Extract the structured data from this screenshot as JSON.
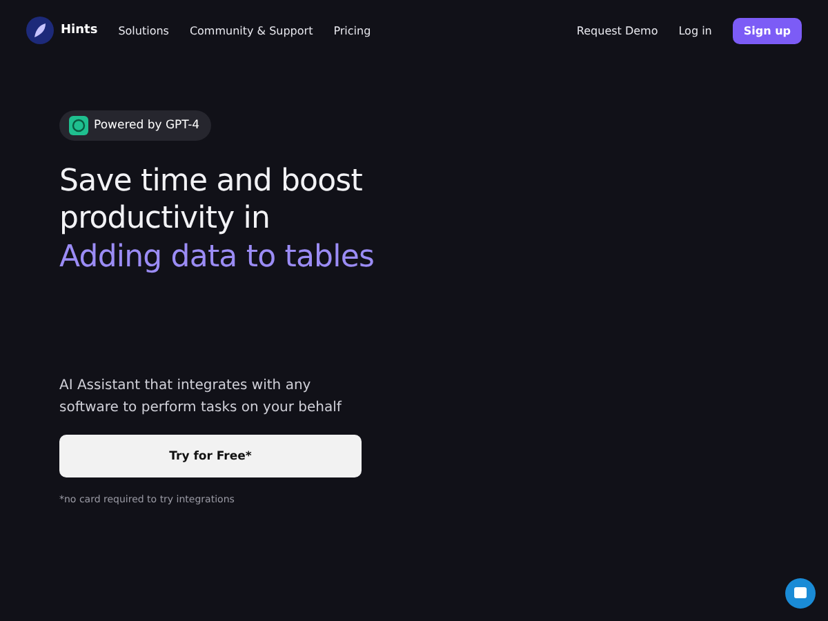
{
  "nav": {
    "brand": "Hints",
    "links": [
      "Solutions",
      "Community & Support",
      "Pricing"
    ],
    "actions": [
      "Request Demo",
      "Log in"
    ],
    "cta": "Sign up"
  },
  "hero": {
    "badge": "Powered by GPT-4",
    "title": "Save time and boost productivity in",
    "highlight": "Adding data to tables",
    "description": "AI Assistant that integrates with any software to perform tasks on your behalf",
    "button": "Try for Free*",
    "note": "*no card required to try integrations"
  }
}
